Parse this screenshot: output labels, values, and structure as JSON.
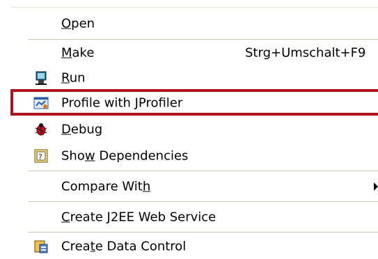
{
  "menu": {
    "items": [
      {
        "label_pre": "",
        "mnemonic": "O",
        "label_post": "pen",
        "shortcut": ""
      },
      {
        "label_pre": "",
        "mnemonic": "M",
        "label_post": "ake",
        "shortcut": "Strg+Umschalt+F9"
      },
      {
        "label_pre": "",
        "mnemonic": "R",
        "label_post": "un",
        "icon": "run-icon"
      },
      {
        "label_pre": "Profile with JProfiler",
        "mnemonic": "",
        "label_post": "",
        "icon": "jprofiler-icon"
      },
      {
        "label_pre": "",
        "mnemonic": "D",
        "label_post": "ebug",
        "icon": "bug-icon"
      },
      {
        "label_pre": "Sho",
        "mnemonic": "w",
        "label_post": " Dependencies",
        "icon": "dependencies-icon"
      },
      {
        "label_pre": "Compare Wit",
        "mnemonic": "h",
        "label_post": "",
        "submenu": true
      },
      {
        "label_pre": "",
        "mnemonic": "C",
        "label_post": "reate J2EE Web Service"
      },
      {
        "label_pre": "Crea",
        "mnemonic": "t",
        "label_post": "e Data Control",
        "icon": "data-control-icon"
      }
    ]
  },
  "colors": {
    "highlight_border": "#b0121b",
    "separator": "#c9c6b8"
  }
}
